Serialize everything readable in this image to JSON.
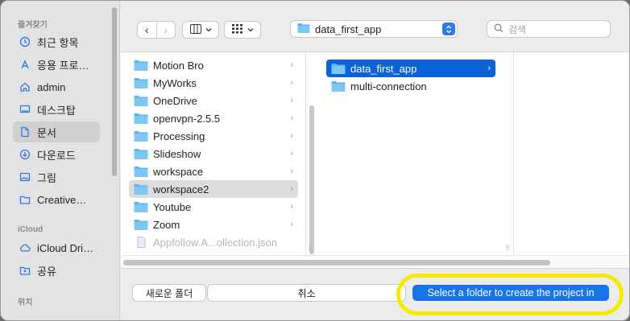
{
  "sidebar": {
    "favorites_header": "즐겨찾기",
    "favorites": [
      {
        "label": "최근 항목",
        "icon": "clock-icon"
      },
      {
        "label": "응용 프로…",
        "icon": "applications-icon"
      },
      {
        "label": "admin",
        "icon": "home-icon"
      },
      {
        "label": "데스크탑",
        "icon": "desktop-icon"
      },
      {
        "label": "문서",
        "icon": "document-icon",
        "selected": true
      },
      {
        "label": "다운로드",
        "icon": "download-icon"
      },
      {
        "label": "그림",
        "icon": "pictures-icon"
      },
      {
        "label": "Creative…",
        "icon": "folder-icon"
      }
    ],
    "icloud_header": "iCloud",
    "icloud": [
      {
        "label": "iCloud Dri…",
        "icon": "cloud-icon"
      },
      {
        "label": "공유",
        "icon": "shared-folder-icon"
      }
    ],
    "locations_header": "위치"
  },
  "toolbar": {
    "back": "‹",
    "forward": "›",
    "path_folder": "data_first_app",
    "search_placeholder": "검색"
  },
  "columns": {
    "col1": [
      {
        "label": "Motion Bro",
        "has_children": true
      },
      {
        "label": "MyWorks",
        "has_children": true
      },
      {
        "label": "OneDrive",
        "has_children": true,
        "icon": "onedrive-folder-icon"
      },
      {
        "label": "openvpn-2.5.5",
        "has_children": true
      },
      {
        "label": "Processing",
        "has_children": true
      },
      {
        "label": "Slideshow",
        "has_children": true
      },
      {
        "label": "workspace",
        "has_children": true
      },
      {
        "label": "workspace2",
        "has_children": true,
        "selected": true
      },
      {
        "label": "Youtube",
        "has_children": true
      },
      {
        "label": "Zoom",
        "has_children": true
      },
      {
        "label": "Appfollow.A...ollection.json",
        "has_children": false,
        "dimmed": true
      }
    ],
    "col2": [
      {
        "label": "data_first_app",
        "has_children": true,
        "selected": true
      },
      {
        "label": "multi-connection",
        "has_children": false
      }
    ]
  },
  "bottom": {
    "new_folder": "새로운 폴더",
    "cancel": "취소",
    "open": "Select a folder to create the project in"
  },
  "colors": {
    "accent": "#0a64d8",
    "folder": "#5ab4ee",
    "highlight": "#f5ea00"
  }
}
